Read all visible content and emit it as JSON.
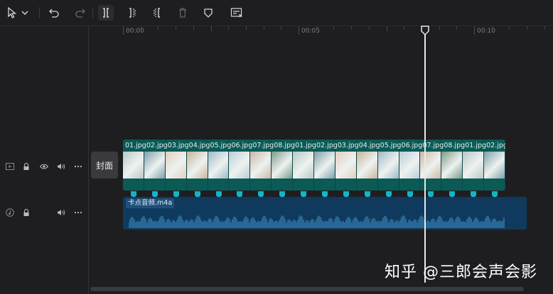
{
  "toolbar": {
    "icons": [
      "cursor-select-icon",
      "chevron-down-icon",
      "undo-icon",
      "redo-icon",
      "split-icon",
      "split-left-icon",
      "split-right-icon",
      "delete-icon",
      "freeze-shield-icon",
      "edit-caption-icon"
    ]
  },
  "ruler": {
    "ticks": [
      "00:00",
      "00:05",
      "00:10"
    ]
  },
  "cover": {
    "label": "封面"
  },
  "video_track": {
    "clips": [
      {
        "label": "01.jpg",
        "color": "#b8c9c6"
      },
      {
        "label": "02.jpg",
        "color": "#7f9fa8"
      },
      {
        "label": "03.jpg",
        "color": "#e1cfc0"
      },
      {
        "label": "04.jpg",
        "color": "#c8b59c"
      },
      {
        "label": "05.jpg",
        "color": "#9fb9c8"
      },
      {
        "label": "06.jpg",
        "color": "#b9cfd8"
      },
      {
        "label": "07.jpg",
        "color": "#cbb8a7"
      },
      {
        "label": "08.jpg",
        "color": "#7a9a86"
      },
      {
        "label": "01.jpg",
        "color": "#b8c9c6"
      },
      {
        "label": "02.jpg",
        "color": "#7f9fa8"
      },
      {
        "label": "03.jpg",
        "color": "#e1cfc0"
      },
      {
        "label": "04.jpg",
        "color": "#c8b59c"
      },
      {
        "label": "05.jpg",
        "color": "#9fb9c8"
      },
      {
        "label": "06.jpg",
        "color": "#b9cfd8"
      },
      {
        "label": "07.jpg",
        "color": "#cbb8a7"
      },
      {
        "label": "08.jpg",
        "color": "#7a9a86"
      },
      {
        "label": "01.jpg",
        "color": "#b8c9c6"
      },
      {
        "label": "02.jpg",
        "color": "#7f9fa8"
      }
    ]
  },
  "audio_track": {
    "label": "卡点音频.m4a"
  },
  "watermark": {
    "text": "知乎 @三郎会声会影"
  },
  "colors": {
    "accent": "#17b3c4",
    "video_bg": "#0b5a56",
    "audio_bg": "#0f3a5e",
    "playhead": "#e9e9e9"
  }
}
